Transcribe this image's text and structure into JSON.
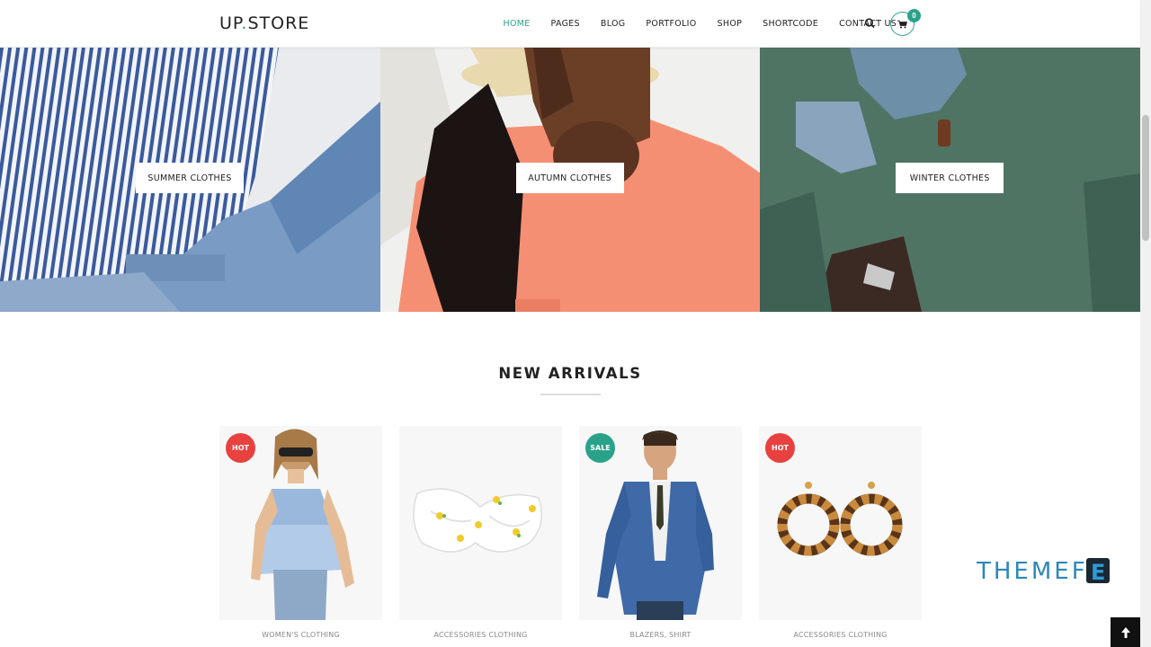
{
  "header": {
    "logo_left": "UP",
    "logo_dot": ".",
    "logo_right": "STORE",
    "nav": [
      {
        "label": "HOME",
        "active": true
      },
      {
        "label": "PAGES",
        "active": false
      },
      {
        "label": "BLOG",
        "active": false
      },
      {
        "label": "PORTFOLIO",
        "active": false
      },
      {
        "label": "SHOP",
        "active": false
      },
      {
        "label": "SHORTCODE",
        "active": false
      },
      {
        "label": "CONTACT US",
        "active": false
      }
    ],
    "search_icon": "search-icon",
    "cart_icon": "cart-icon",
    "cart_count": "0"
  },
  "banners": [
    {
      "label": "SUMMER CLOTHES"
    },
    {
      "label": "AUTUMN CLOTHES"
    },
    {
      "label": "WINTER CLOTHES"
    }
  ],
  "section": {
    "title": "NEW ARRIVALS"
  },
  "products": [
    {
      "badge": "HOT",
      "badge_color": "#e8413f",
      "category": "WOMEN'S CLOTHING"
    },
    {
      "badge": "",
      "badge_color": "",
      "category": "ACCESSORIES CLOTHING"
    },
    {
      "badge": "SALE",
      "badge_color": "#2aa28a",
      "category": "BLAZERS, SHIRT"
    },
    {
      "badge": "HOT",
      "badge_color": "#e8413f",
      "category": "ACCESSORIES CLOTHING"
    }
  ],
  "watermark": {
    "text": "THEMEFR",
    "logo_letter": "E"
  },
  "colors": {
    "accent": "#2aa28a",
    "hot": "#e8413f"
  },
  "scroll_top_icon": "arrow-up-icon"
}
